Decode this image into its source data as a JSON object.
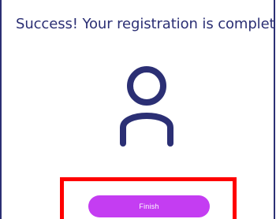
{
  "header": {
    "title": "Success! Your registration is complete"
  },
  "icon": {
    "name": "user-icon",
    "color": "#2b2f74"
  },
  "actions": {
    "finish_label": "Finish"
  },
  "colors": {
    "accent": "#c43df2",
    "text": "#2b2f74",
    "highlight": "#ff0000"
  }
}
